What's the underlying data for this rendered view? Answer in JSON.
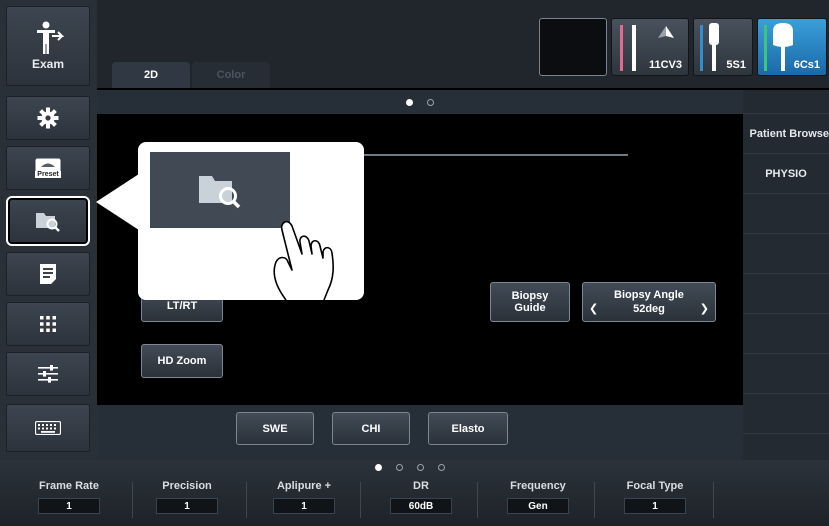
{
  "sidebar": {
    "exam_label": "Exam",
    "preset_label": "Preset"
  },
  "tabs": [
    {
      "label": "2D",
      "active": true
    },
    {
      "label": "Color",
      "active": false
    }
  ],
  "probes": [
    "11CV3",
    "5S1",
    "6Cs1"
  ],
  "main": {
    "lr_label": "LT/RT",
    "hd_zoom_label": "HD Zoom",
    "biopsy_guide_line1": "Biopsy",
    "biopsy_guide_line2": "Guide",
    "biopsy_angle_label": "Biopsy Angle",
    "biopsy_angle_value": "52deg"
  },
  "right_column": {
    "patient_browser_label": "Patient Browse",
    "physio_label": "PHYSIO"
  },
  "lower_buttons": [
    "SWE",
    "CHI",
    "Elasto"
  ],
  "status_params": [
    {
      "label": "Frame Rate",
      "value": "1"
    },
    {
      "label": "Precision",
      "value": "1"
    },
    {
      "label": "Aplipure +",
      "value": "1"
    },
    {
      "label": "DR",
      "value": "60dB"
    },
    {
      "label": "Frequency",
      "value": "Gen"
    },
    {
      "label": "Focal Type",
      "value": "1"
    }
  ],
  "colors": {
    "selected_probe": "#2f8fd0",
    "probe_pink": "#e06a90",
    "probe_green": "#3fc47a"
  }
}
